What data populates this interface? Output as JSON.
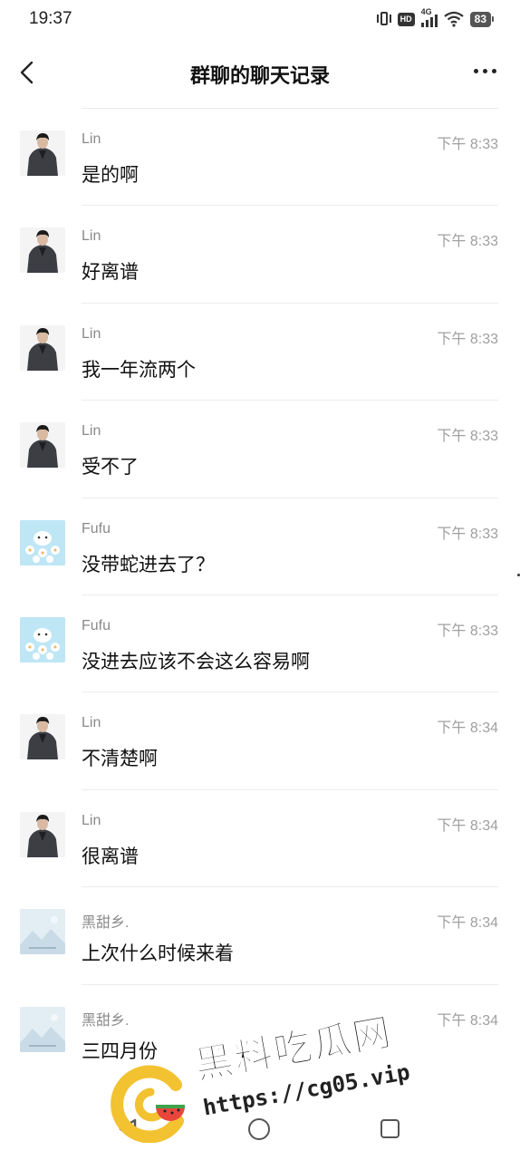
{
  "status_bar": {
    "time": "19:37",
    "network": "4G",
    "hd": "HD",
    "battery": "83"
  },
  "header": {
    "title": "群聊的聊天记录"
  },
  "messages": [
    {
      "name": "Lin",
      "time": "下午 8:33",
      "text": "是的啊",
      "avatar": "lin"
    },
    {
      "name": "Lin",
      "time": "下午 8:33",
      "text": "好离谱",
      "avatar": "lin"
    },
    {
      "name": "Lin",
      "time": "下午 8:33",
      "text": "我一年流两个",
      "avatar": "lin"
    },
    {
      "name": "Lin",
      "time": "下午 8:33",
      "text": "受不了",
      "avatar": "lin"
    },
    {
      "name": "Fufu",
      "time": "下午 8:33",
      "text": "没带蛇进去了？",
      "avatar": "fufu"
    },
    {
      "name": "Fufu",
      "time": "下午 8:33",
      "text": "没进去应该不会这么容易啊",
      "avatar": "fufu"
    },
    {
      "name": "Lin",
      "time": "下午 8:34",
      "text": "不清楚啊",
      "avatar": "lin"
    },
    {
      "name": "Lin",
      "time": "下午 8:34",
      "text": "很离谱",
      "avatar": "lin"
    },
    {
      "name": "黑甜乡.",
      "time": "下午 8:34",
      "text": "上次什么时候来着",
      "avatar": "hei"
    },
    {
      "name": "黑甜乡.",
      "time": "下午 8:34",
      "text": "三四月份",
      "avatar": "hei"
    }
  ],
  "watermark": {
    "title": "黑料吃瓜网",
    "url": "https://cg05.vip"
  },
  "colors": {
    "name_gray": "#8a8a8a",
    "time_gray": "#a0a0a0",
    "divider": "#ececec"
  }
}
